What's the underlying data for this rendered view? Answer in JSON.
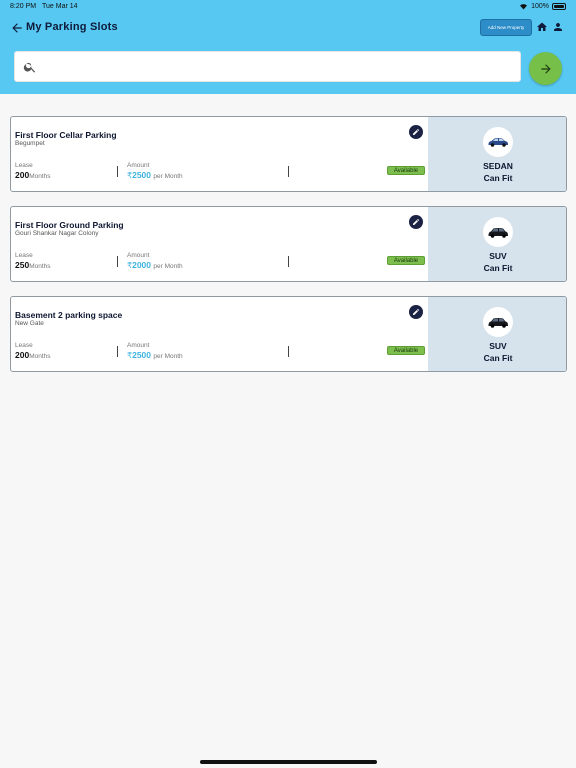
{
  "status_bar": {
    "time": "8:20 PM",
    "date": "Tue Mar 14",
    "battery": "100%"
  },
  "header": {
    "title": "My Parking Slots",
    "add_button_label": "Add New Property",
    "background_color": "#57c8f2"
  },
  "search": {
    "value": "",
    "placeholder": ""
  },
  "go_button": {
    "icon": "arrow-right-icon",
    "color": "#76bf48"
  },
  "slots": [
    {
      "title": "First Floor Cellar Parking",
      "location": "Begumpet",
      "lease_label": "Lease",
      "lease_value": "200",
      "lease_unit": "Months",
      "amount_label": "Amount",
      "currency": "₹",
      "amount_value": "2500",
      "amount_unit": "per Month",
      "status": "Available",
      "vehicle_type": "SEDAN",
      "fit_label": "Can Fit"
    },
    {
      "title": "First Floor Ground Parking",
      "location": "Gouri Shankar Nagar Colony",
      "lease_label": "Lease",
      "lease_value": "250",
      "lease_unit": "Months",
      "amount_label": "Amount",
      "currency": "₹",
      "amount_value": "2000",
      "amount_unit": "per Month",
      "status": "Available",
      "vehicle_type": "SUV",
      "fit_label": "Can Fit"
    },
    {
      "title": "Basement 2 parking space",
      "location": "New Gate",
      "lease_label": "Lease",
      "lease_value": "200",
      "lease_unit": "Months",
      "amount_label": "Amount",
      "currency": "₹",
      "amount_value": "2500",
      "amount_unit": "per Month",
      "status": "Available",
      "vehicle_type": "SUV",
      "fit_label": "Can Fit"
    }
  ]
}
